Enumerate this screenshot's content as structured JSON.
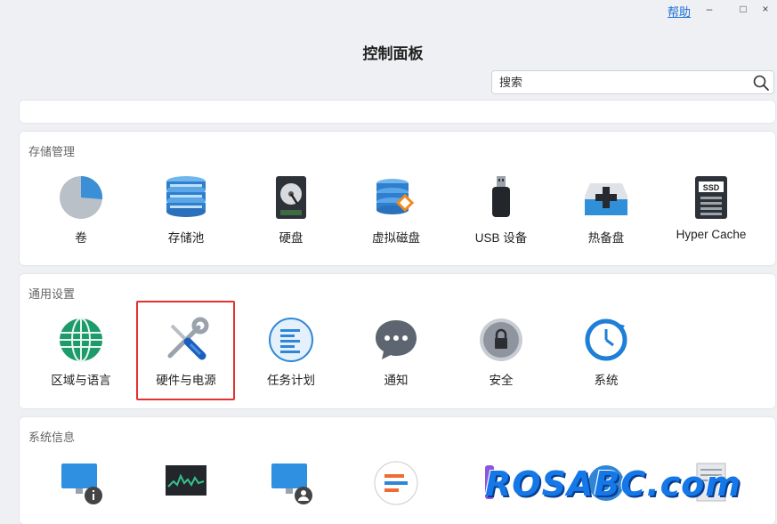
{
  "titlebar": {
    "help": "帮助",
    "minimize": "–",
    "maximize": "□",
    "close": "×"
  },
  "page_title": "控制面板",
  "search": {
    "placeholder": "搜索"
  },
  "sections": {
    "storage": {
      "title": "存储管理",
      "items": [
        "卷",
        "存储池",
        "硬盘",
        "虚拟磁盘",
        "USB 设备",
        "热备盘",
        "Hyper Cache"
      ]
    },
    "general": {
      "title": "通用设置",
      "items": [
        "区域与语言",
        "硬件与电源",
        "任务计划",
        "通知",
        "安全",
        "系统"
      ]
    },
    "sysinfo": {
      "title": "系统信息"
    }
  },
  "icon_text": {
    "ssd": "SSD"
  },
  "watermark": "ROSABC.com",
  "colors": {
    "accent": "#1a6fd8",
    "highlight": "#e23232"
  }
}
